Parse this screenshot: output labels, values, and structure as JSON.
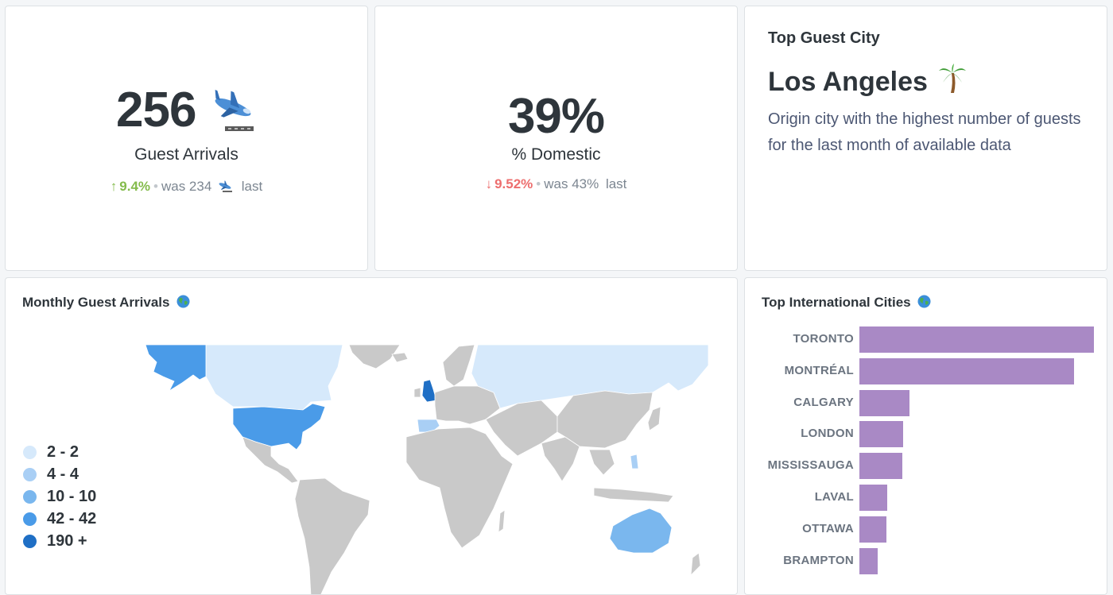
{
  "guest_arrivals": {
    "value": "256",
    "title": "Guest Arrivals",
    "change": "9.4%",
    "direction": "up",
    "previous": "was 234",
    "period": "last",
    "icon": "airplane-arriving-icon"
  },
  "domestic": {
    "value": "39%",
    "title": "% Domestic",
    "change": "9.52%",
    "direction": "down",
    "previous": "was 43%",
    "period": "last"
  },
  "top_city": {
    "title": "Top Guest City",
    "city": "Los Angeles",
    "icon": "palm-tree-icon",
    "description": "Origin city with the highest number of guests for the last month of available data"
  },
  "map_card": {
    "title": "Monthly Guest Arrivals",
    "icon": "globe-icon",
    "legend": [
      {
        "label": "2 - 2",
        "color": "#d6e9fb"
      },
      {
        "label": "4 - 4",
        "color": "#a9cff5"
      },
      {
        "label": "10 - 10",
        "color": "#7ab7ee"
      },
      {
        "label": "42 - 42",
        "color": "#4a9be8"
      },
      {
        "label": "190 +",
        "color": "#1f6fc5"
      }
    ],
    "colors": {
      "no_data": "#c9c9c9",
      "border": "#ffffff"
    }
  },
  "intl_card": {
    "title": "Top International Cities",
    "icon": "globe-icon",
    "bar_color": "#a989c5"
  },
  "chart_data": {
    "type": "bar",
    "orientation": "horizontal",
    "categories": [
      "TORONTO",
      "MONTRÉAL",
      "CALGARY",
      "LONDON",
      "MISSISSAUGA",
      "LAVAL",
      "OTTAWA",
      "BRAMPTON"
    ],
    "values": [
      59,
      54,
      12.5,
      11,
      10.8,
      7,
      6.8,
      4.5
    ],
    "xlim": [
      0,
      60
    ],
    "grid": false,
    "legend": "none"
  }
}
